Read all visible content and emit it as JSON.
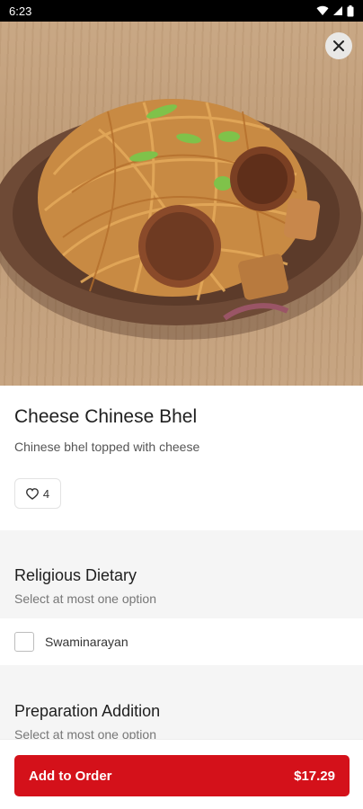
{
  "status": {
    "time": "6:23"
  },
  "item": {
    "title": "Cheese Chinese Bhel",
    "description": "Chinese bhel topped with cheese",
    "likes": "4"
  },
  "sections": [
    {
      "title": "Religious Dietary",
      "subtitle": "Select at most one option",
      "options": [
        {
          "label": "Swaminarayan",
          "checked": false
        }
      ]
    },
    {
      "title": "Preparation Addition",
      "subtitle": "Select at most one option"
    }
  ],
  "cta": {
    "label": "Add to Order",
    "price": "$17.29"
  },
  "colors": {
    "accent": "#d4111a",
    "plate": "#6e4a36",
    "table": "#c4a07c"
  },
  "icons": {
    "close": "close-icon",
    "like": "heart-icon",
    "wifi": "wifi-icon",
    "signal": "signal-icon",
    "battery": "battery-icon"
  }
}
